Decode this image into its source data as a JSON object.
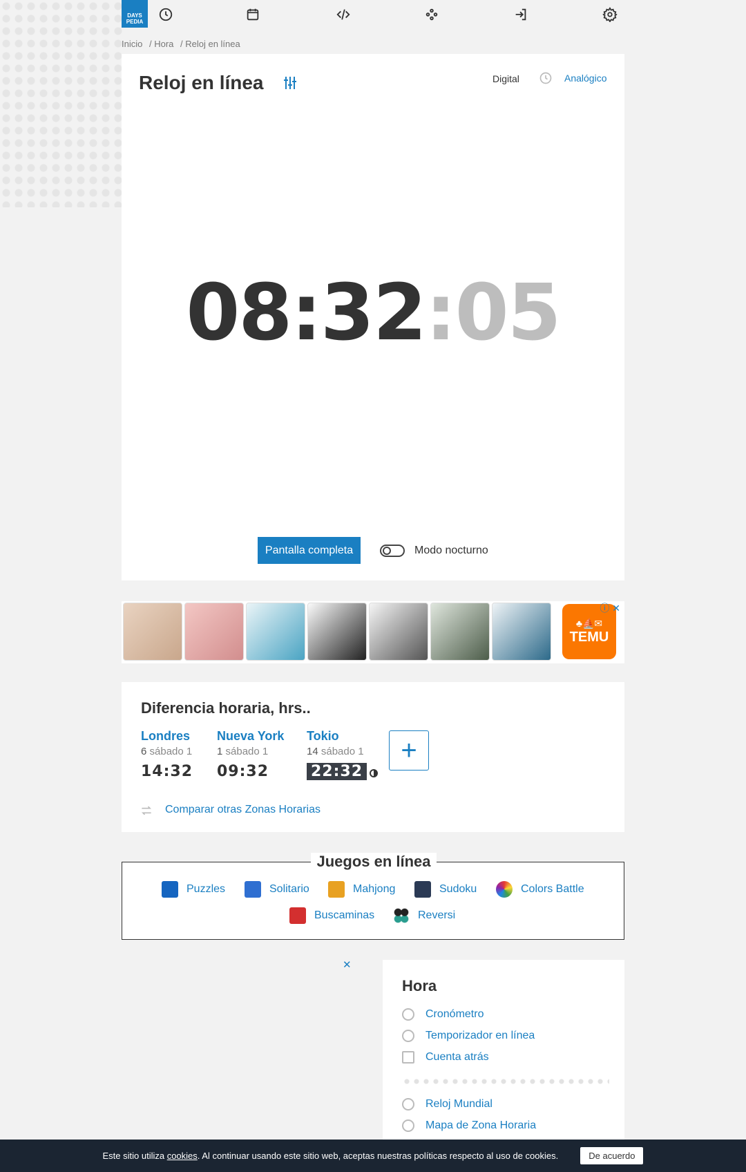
{
  "nav": {
    "logo_line1": "DAYS",
    "logo_line2": "PEDIA",
    "icons": [
      "clock-icon",
      "calendar-icon",
      "code-icon",
      "apps-icon",
      "login-icon",
      "settings-icon"
    ]
  },
  "breadcrumb": [
    "Inicio",
    "/  Hora",
    "/  Reloj en línea"
  ],
  "clock_card": {
    "title": "Reloj en línea",
    "view_digital": "Digital",
    "view_analog": "Analógico",
    "time_main": "08:32",
    "time_seconds": ":05",
    "fullscreen": "Pantalla completa",
    "night_mode": "Modo nocturno"
  },
  "ad": {
    "brand": "TEMU",
    "close": "✕",
    "info": "ⓘ"
  },
  "timezones": {
    "title": "Diferencia horaria, hrs..",
    "items": [
      {
        "city": "Londres",
        "diff": "6",
        "day": "sábado 1",
        "time": "14:32"
      },
      {
        "city": "Nueva York",
        "diff": "1",
        "day": "sábado 1",
        "time": "09:32"
      },
      {
        "city": "Tokio",
        "diff": "14",
        "day": "sábado 1",
        "time": "22:32"
      }
    ],
    "add": "+",
    "compare": "Comparar otras Zonas Horarias"
  },
  "games": {
    "title": "Juegos en línea",
    "items": [
      "Puzzles",
      "Solitario",
      "Mahjong",
      "Sudoku",
      "Colors Battle",
      "Buscaminas",
      "Reversi"
    ]
  },
  "sidebar": {
    "title": "Hora",
    "links": [
      "Cronómetro",
      "Temporizador en línea",
      "Cuenta atrás",
      "Reloj Mundial",
      "Mapa de Zona Horaria"
    ]
  },
  "cookie": {
    "text_before": "Este sitio utiliza ",
    "link": "cookies",
    "text_after": ". Al continuar usando este sitio web, aceptas nuestras políticas respecto al uso de cookies.",
    "button": "De acuerdo"
  },
  "colors": {
    "accent": "#1a7fc2",
    "temu": "#fb7701",
    "cookie_bg": "#1b2532"
  }
}
